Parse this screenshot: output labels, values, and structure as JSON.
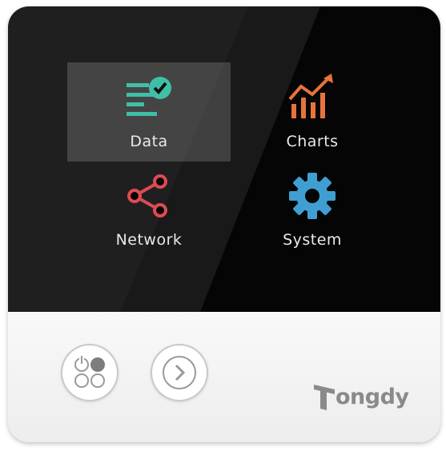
{
  "menu": {
    "items": [
      {
        "label": "Data",
        "icon": "data-check-icon",
        "color": "#3fbfa6",
        "selected": true
      },
      {
        "label": "Charts",
        "icon": "bar-chart-icon",
        "color": "#e8733c",
        "selected": false
      },
      {
        "label": "Network",
        "icon": "share-network-icon",
        "color": "#e04a52",
        "selected": false
      },
      {
        "label": "System",
        "icon": "gear-icon",
        "color": "#3f9fd3",
        "selected": false
      }
    ]
  },
  "buttons": {
    "power_mode": "power-mode-icon",
    "next": "chevron-right-icon"
  },
  "brand": {
    "name": "ongdy",
    "logo_icon": "brand-t-logo-icon"
  }
}
